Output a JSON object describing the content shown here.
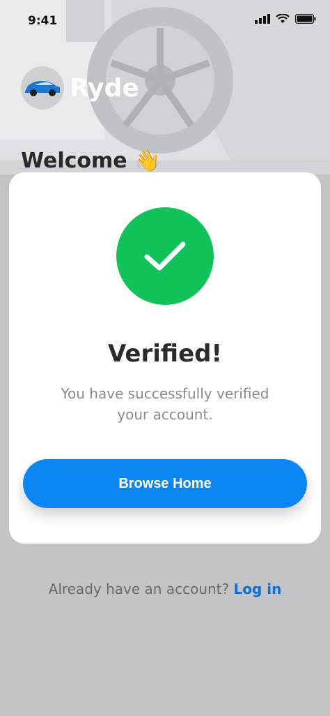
{
  "status_bar": {
    "time": "9:41",
    "icons": [
      "signal-icon",
      "wifi-icon",
      "battery-icon"
    ]
  },
  "brand": {
    "name": "Ryde",
    "logo_icon": "car-icon"
  },
  "hero": {
    "heading": "Welcome",
    "emoji": "👋"
  },
  "modal": {
    "icon": "check-icon",
    "title": "Verified!",
    "subtitle": "You have successfully verified your account.",
    "button_label": "Browse Home"
  },
  "footer": {
    "prompt": "Already have an account?",
    "link_label": "Log in"
  },
  "colors": {
    "success": "#12c25b",
    "primary": "#0b86f3",
    "link": "#0c6fd1"
  }
}
